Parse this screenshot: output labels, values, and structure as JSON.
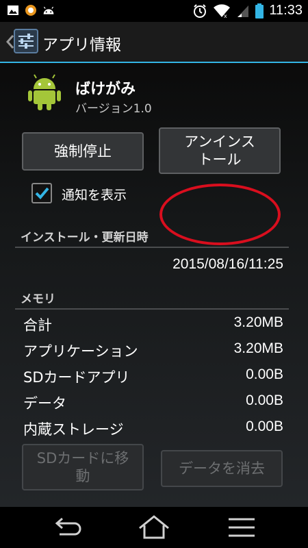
{
  "status_bar": {
    "time": "11:33",
    "left_icons": [
      "image-icon",
      "app-circle-icon",
      "android-head-icon"
    ],
    "right_icons": [
      "alarm-icon",
      "wifi-icon",
      "signal-icon",
      "battery-icon"
    ],
    "accent": "#33b5e5"
  },
  "action_bar": {
    "title": "アプリ情報"
  },
  "app": {
    "name": "ばけがみ",
    "version": "バージョン1.0"
  },
  "buttons": {
    "force_stop": "強制停止",
    "uninstall_line1": "アンインス",
    "uninstall_line2": "トール",
    "move_to_sd_line1": "SDカードに移",
    "move_to_sd_line2": "動",
    "clear_data": "データを消去"
  },
  "notification": {
    "label": "通知を表示",
    "checked": true
  },
  "install_section": {
    "title": "インストール・更新日時",
    "date": "2015/08/16/11:25"
  },
  "memory_section": {
    "title": "メモリ",
    "rows": [
      {
        "label": "合計",
        "value": "3.20MB"
      },
      {
        "label": "アプリケーション",
        "value": "3.20MB"
      },
      {
        "label": "SDカードアプリ",
        "value": "0.00B"
      },
      {
        "label": "データ",
        "value": "0.00B"
      },
      {
        "label": "内蔵ストレージ",
        "value": "0.00B"
      }
    ]
  },
  "colors": {
    "annotation": "#d90e1e",
    "checkbox": "#33b5e5"
  },
  "nav_bar": {
    "icons": [
      "back-icon",
      "home-icon",
      "menu-icon"
    ]
  }
}
